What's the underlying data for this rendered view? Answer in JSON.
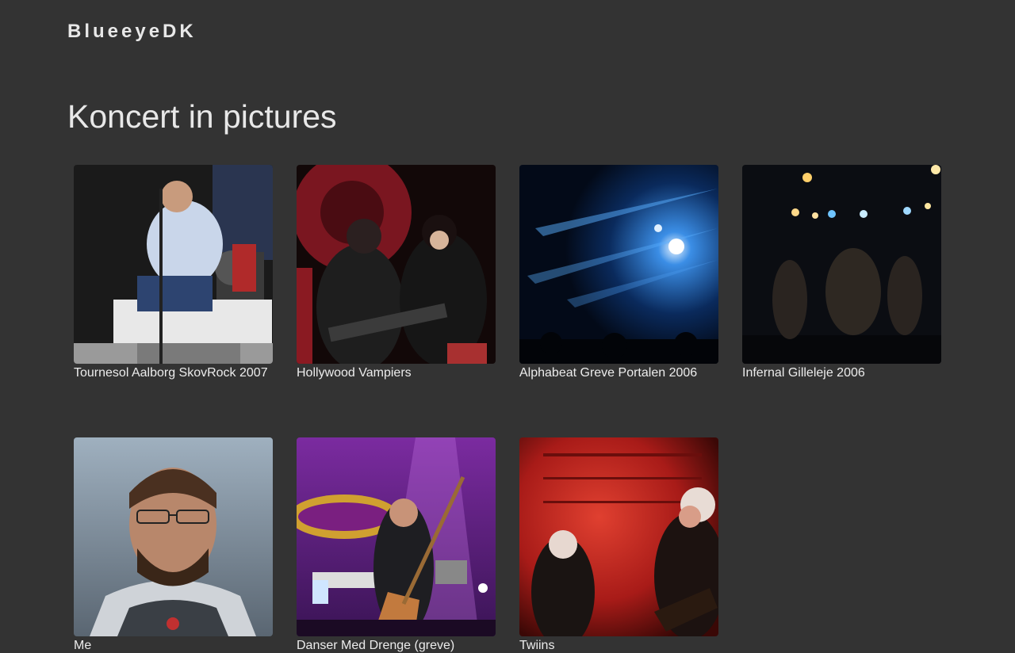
{
  "site": {
    "brand": "BlueeyeDK"
  },
  "page": {
    "title": "Koncert in pictures"
  },
  "gallery": [
    {
      "caption": "Tournesol Aalborg SkovRock 2007",
      "icon": "singer-photo"
    },
    {
      "caption": "Hollywood Vampiers",
      "icon": "band-photo"
    },
    {
      "caption": "Alphabeat Greve Portalen 2006",
      "icon": "stage-lights-photo"
    },
    {
      "caption": "Infernal Gilleleje 2006",
      "icon": "silhouette-stage-photo"
    },
    {
      "caption": "Me",
      "icon": "portrait-photo"
    },
    {
      "caption": "Danser Med Drenge (greve)",
      "icon": "bassist-photo"
    },
    {
      "caption": "Twiins",
      "icon": "red-stage-photo"
    }
  ]
}
